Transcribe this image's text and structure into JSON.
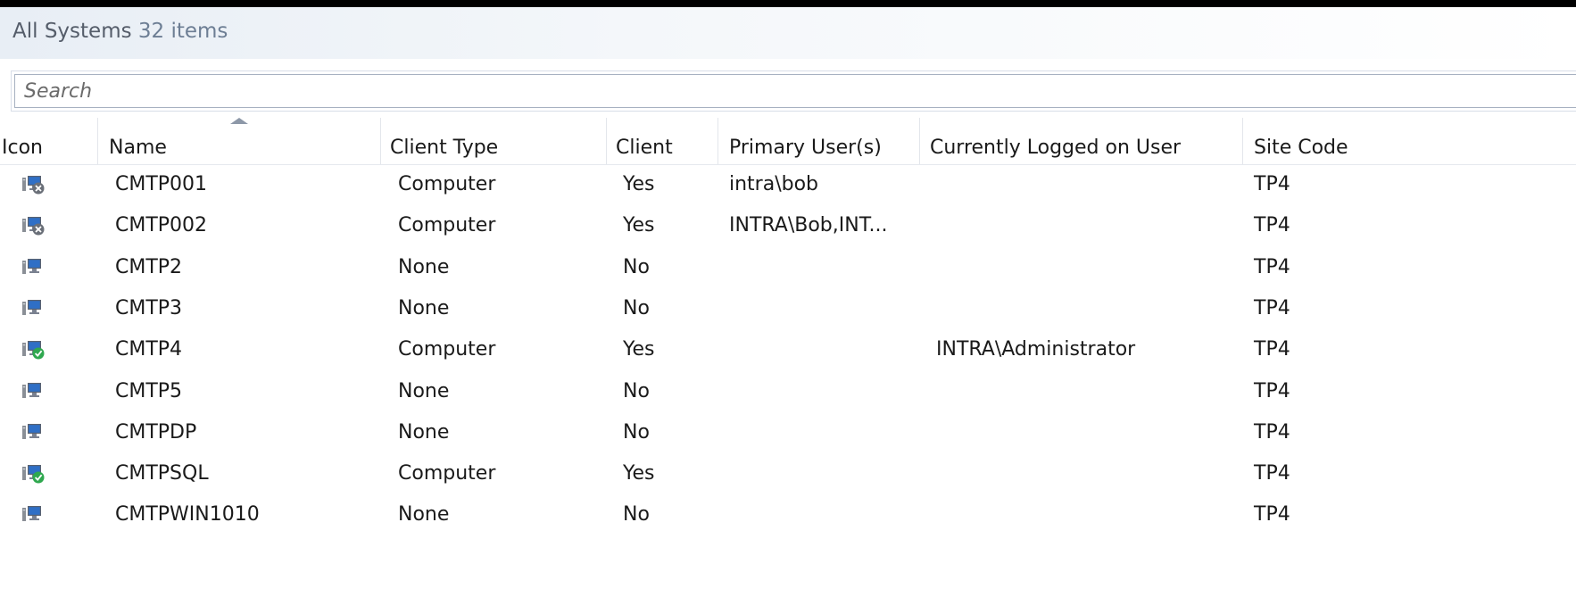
{
  "header": {
    "title": "All Systems",
    "count": "32 items"
  },
  "search": {
    "placeholder": "Search"
  },
  "columns": [
    "Icon",
    "Name",
    "Client Type",
    "Client",
    "Primary User(s)",
    "Currently Logged on User",
    "Site Code"
  ],
  "colors": {
    "accent": "#2f6fc6",
    "ok": "#2fa84f",
    "error": "#6a6f78"
  },
  "rows": [
    {
      "icon": "computer-error-icon",
      "name": "CMTP001",
      "client_type": "Computer",
      "client": "Yes",
      "primary_users": "intra\\bob",
      "logged_on": "",
      "site_code": "TP4"
    },
    {
      "icon": "computer-error-icon",
      "name": "CMTP002",
      "client_type": "Computer",
      "client": "Yes",
      "primary_users": "INTRA\\Bob,INT...",
      "logged_on": "",
      "site_code": "TP4"
    },
    {
      "icon": "computer-icon",
      "name": "CMTP2",
      "client_type": "None",
      "client": "No",
      "primary_users": "",
      "logged_on": "",
      "site_code": "TP4"
    },
    {
      "icon": "computer-icon",
      "name": "CMTP3",
      "client_type": "None",
      "client": "No",
      "primary_users": "",
      "logged_on": "",
      "site_code": "TP4"
    },
    {
      "icon": "computer-ok-icon",
      "name": "CMTP4",
      "client_type": "Computer",
      "client": "Yes",
      "primary_users": "",
      "logged_on": "INTRA\\Administrator",
      "site_code": "TP4"
    },
    {
      "icon": "computer-icon",
      "name": "CMTP5",
      "client_type": "None",
      "client": "No",
      "primary_users": "",
      "logged_on": "",
      "site_code": "TP4"
    },
    {
      "icon": "computer-icon",
      "name": "CMTPDP",
      "client_type": "None",
      "client": "No",
      "primary_users": "",
      "logged_on": "",
      "site_code": "TP4"
    },
    {
      "icon": "computer-ok-icon",
      "name": "CMTPSQL",
      "client_type": "Computer",
      "client": "Yes",
      "primary_users": "",
      "logged_on": "",
      "site_code": "TP4"
    },
    {
      "icon": "computer-icon",
      "name": "CMTPWIN1010",
      "client_type": "None",
      "client": "No",
      "primary_users": "",
      "logged_on": "",
      "site_code": "TP4"
    }
  ]
}
